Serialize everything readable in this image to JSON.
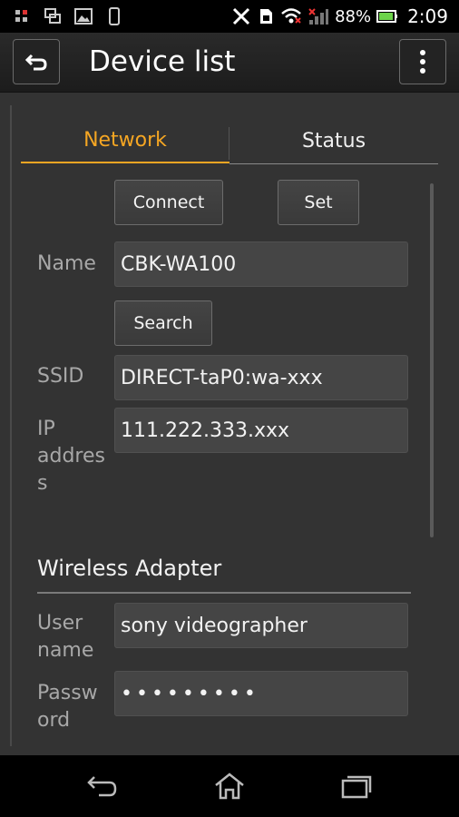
{
  "status_bar": {
    "battery": "88%",
    "time": "2:09"
  },
  "action_bar": {
    "title": "Device list"
  },
  "tabs": [
    {
      "label": "Network",
      "active": true
    },
    {
      "label": "Status",
      "active": false
    }
  ],
  "buttons": {
    "connect": "Connect",
    "set": "Set",
    "search": "Search"
  },
  "fields": {
    "name": {
      "label": "Name",
      "value": "CBK-WA100"
    },
    "ssid": {
      "label": "SSID",
      "value": "DIRECT-taP0:wa-xxx"
    },
    "ip": {
      "label_line1": "IP",
      "label_line2": "addres",
      "label_line3": "s",
      "value": "111.222.333.xxx"
    }
  },
  "section": {
    "title": "Wireless Adapter"
  },
  "adapter_fields": {
    "user": {
      "label_line1": "User",
      "label_line2": "name",
      "value": "sony videographer"
    },
    "password": {
      "label_line1": "Passw",
      "label_line2": "ord",
      "value": "•••••••••"
    }
  },
  "colors": {
    "accent": "#f5a623",
    "background": "#333333"
  }
}
